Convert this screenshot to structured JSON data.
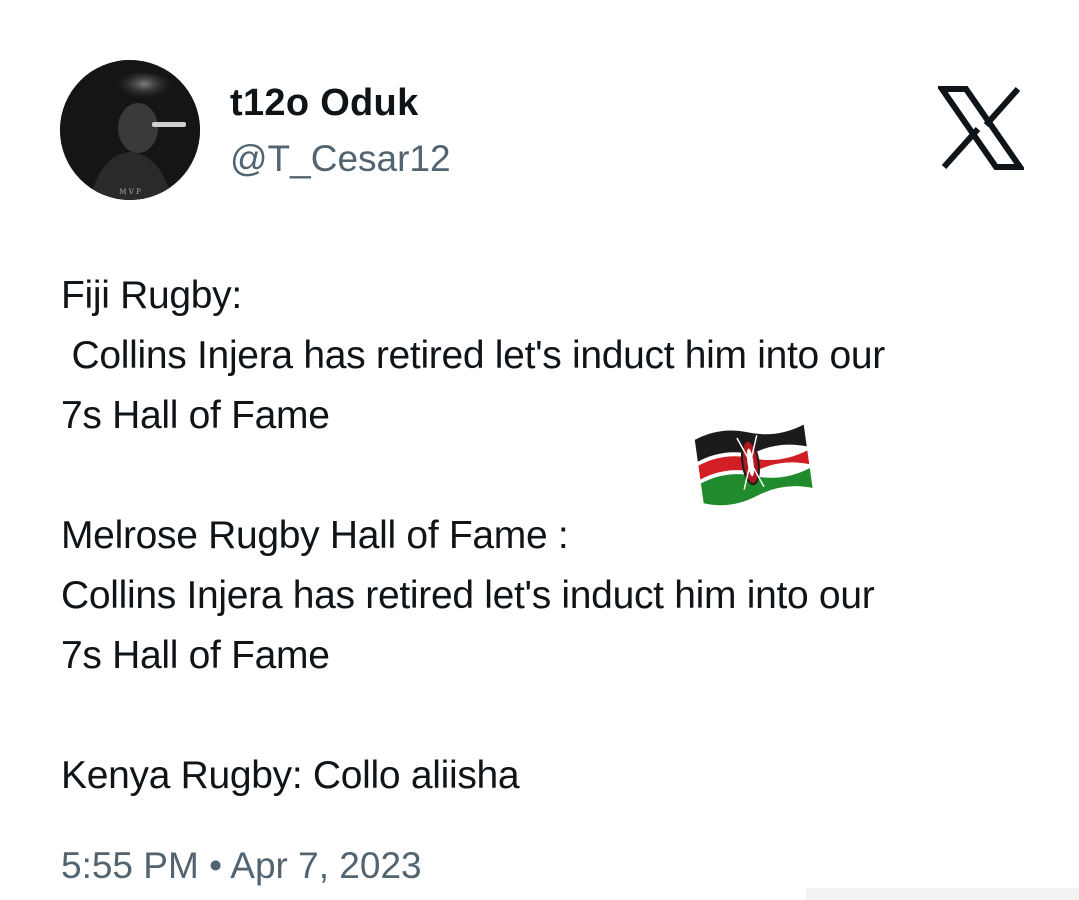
{
  "author": {
    "display_name": "t12o Oduk",
    "handle": "@T_Cesar12",
    "avatar_badge": "M V P"
  },
  "platform": {
    "logo_icon": "x-logo-icon"
  },
  "tweet": {
    "lines": [
      "Fiji Rugby:",
      " Collins Injera has retired let's induct him into our",
      "7s Hall of Fame",
      "",
      "Melrose Rugby Hall of Fame :",
      "Collins Injera has retired let's induct him into our",
      "7s Hall of Fame",
      "",
      "Kenya Rugby: Collo aliisha"
    ],
    "emoji": "kenya-flag-icon",
    "time": "5:55 PM",
    "separator": "•",
    "date": "Apr 7, 2023"
  },
  "colors": {
    "text": "#0f1419",
    "secondary": "#536471",
    "flag_black": "#1b1b1b",
    "flag_red": "#d21f26",
    "flag_green": "#1f8b2c"
  }
}
